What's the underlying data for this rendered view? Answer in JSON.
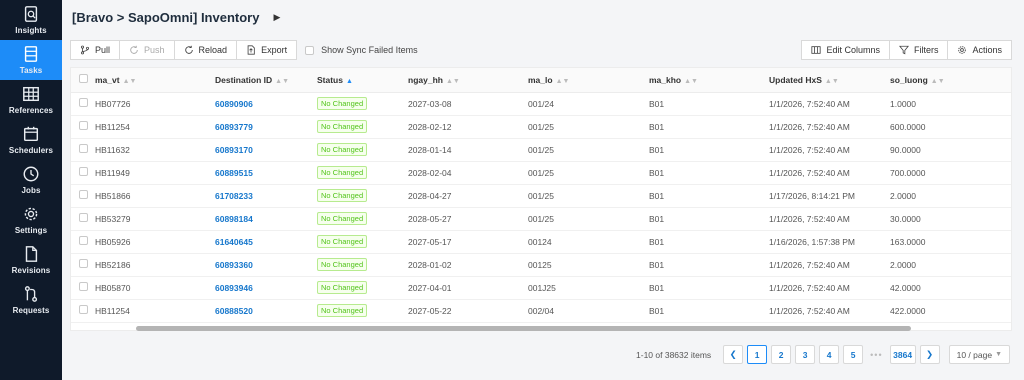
{
  "sidebar": {
    "items": [
      {
        "label": "Insights",
        "icon": "insights-icon"
      },
      {
        "label": "Tasks",
        "icon": "tasks-icon",
        "active": true
      },
      {
        "label": "References",
        "icon": "table-icon"
      },
      {
        "label": "Schedulers",
        "icon": "calendar-icon"
      },
      {
        "label": "Jobs",
        "icon": "clock-icon"
      },
      {
        "label": "Settings",
        "icon": "gear-icon"
      },
      {
        "label": "Revisions",
        "icon": "document-icon"
      },
      {
        "label": "Requests",
        "icon": "requests-icon"
      }
    ]
  },
  "header": {
    "title": "[Bravo > SapoOmni] Inventory",
    "caret_icon": "caret-right-icon"
  },
  "toolbar": {
    "pull": "Pull",
    "push": "Push",
    "reload": "Reload",
    "export": "Export",
    "show_sync_failed": "Show Sync Failed Items",
    "edit_columns": "Edit Columns",
    "filters": "Filters",
    "actions": "Actions"
  },
  "table": {
    "columns": [
      "ma_vt",
      "Destination ID",
      "Status",
      "ngay_hh",
      "ma_lo",
      "ma_kho",
      "Updated HxS",
      "so_luong"
    ],
    "sorted_column": "Status",
    "rows": [
      [
        "HB07726",
        "60890906",
        "No Changed",
        "2027-03-08",
        "001/24",
        "B01",
        "1/1/2026, 7:52:40 AM",
        "1.0000"
      ],
      [
        "HB11254",
        "60893779",
        "No Changed",
        "2028-02-12",
        "001/25",
        "B01",
        "1/1/2026, 7:52:40 AM",
        "600.0000"
      ],
      [
        "HB11632",
        "60893170",
        "No Changed",
        "2028-01-14",
        "001/25",
        "B01",
        "1/1/2026, 7:52:40 AM",
        "90.0000"
      ],
      [
        "HB11949",
        "60889515",
        "No Changed",
        "2028-02-04",
        "001/25",
        "B01",
        "1/1/2026, 7:52:40 AM",
        "700.0000"
      ],
      [
        "HB51866",
        "61708233",
        "No Changed",
        "2028-04-27",
        "001/25",
        "B01",
        "1/17/2026, 8:14:21 PM",
        "2.0000"
      ],
      [
        "HB53279",
        "60898184",
        "No Changed",
        "2028-05-27",
        "001/25",
        "B01",
        "1/1/2026, 7:52:40 AM",
        "30.0000"
      ],
      [
        "HB05926",
        "61640645",
        "No Changed",
        "2027-05-17",
        "00124",
        "B01",
        "1/16/2026, 1:57:38 PM",
        "163.0000"
      ],
      [
        "HB52186",
        "60893360",
        "No Changed",
        "2028-01-02",
        "00125",
        "B01",
        "1/1/2026, 7:52:40 AM",
        "2.0000"
      ],
      [
        "HB05870",
        "60893946",
        "No Changed",
        "2027-04-01",
        "001J25",
        "B01",
        "1/1/2026, 7:52:40 AM",
        "42.0000"
      ],
      [
        "HB11254",
        "60888520",
        "No Changed",
        "2027-05-22",
        "002/04",
        "B01",
        "1/1/2026, 7:52:40 AM",
        "422.0000"
      ]
    ]
  },
  "pagination": {
    "info": "1-10 of 38632 items",
    "pages": [
      "1",
      "2",
      "3",
      "4",
      "5"
    ],
    "ellipsis": "•••",
    "last": "3864",
    "page_size": "10 / page"
  },
  "colors": {
    "sidebar_bg": "#0f1a2a",
    "accent": "#1d8cf8",
    "link": "#1677cc",
    "status_green": "#52c41a"
  }
}
